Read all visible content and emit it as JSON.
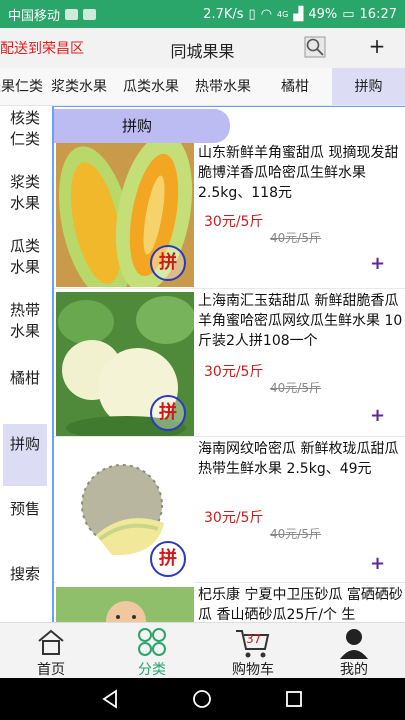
{
  "status": {
    "carrier": "中国移动",
    "speed": "2.7K/s",
    "signal_label": "4G",
    "battery": "49%",
    "time": "16:27"
  },
  "header": {
    "location": "配送到荣昌区",
    "title": "同城果果",
    "plus": "+"
  },
  "tabs": [
    {
      "label": "坚果仁类"
    },
    {
      "label": "浆类水果"
    },
    {
      "label": "瓜类水果"
    },
    {
      "label": "热带水果"
    },
    {
      "label": "橘柑"
    },
    {
      "label": "拼购"
    }
  ],
  "sidebar": [
    {
      "label": "核类仁类"
    },
    {
      "label": "浆类水果"
    },
    {
      "label": "瓜类水果"
    },
    {
      "label": "热带水果"
    },
    {
      "label": "橘柑"
    },
    {
      "label": "拼购"
    },
    {
      "label": "预售"
    },
    {
      "label": "搜索"
    }
  ],
  "section_title": "拼购",
  "pin_label": "拼",
  "products": [
    {
      "title": "山东新鲜羊角蜜甜瓜 现摘现发甜脆博洋香瓜哈密瓜生鲜水果 2.5kg、118元",
      "price": "30元/5斤",
      "orig_price": "40元/5斤"
    },
    {
      "title": "上海南汇玉菇甜瓜 新鲜甜脆香瓜羊角蜜哈密瓜网纹瓜生鲜水果 10斤装2人拼108一个",
      "price": "30元/5斤",
      "orig_price": "40元/5斤"
    },
    {
      "title": "海南网纹哈密瓜 新鲜枚珑瓜甜瓜热带生鲜水果 2.5kg、49元",
      "price": "30元/5斤",
      "orig_price": "40元/5斤"
    },
    {
      "title": "杞乐康 宁夏中卫压砂瓜 富硒硒砂瓜 香山硒砂瓜25斤/个 生",
      "price": "",
      "orig_price": ""
    }
  ],
  "add_symbol": "+",
  "tabbar": {
    "home": "首页",
    "category": "分类",
    "cart": "购物车",
    "cart_count": "37",
    "mine": "我的"
  },
  "colors": {
    "status_bar": "#2aa66b",
    "accent_green": "#2aa66b",
    "price_red": "#c82020",
    "active_tab_bg": "#dcdcf5",
    "section_bg": "#bcbcf2"
  }
}
